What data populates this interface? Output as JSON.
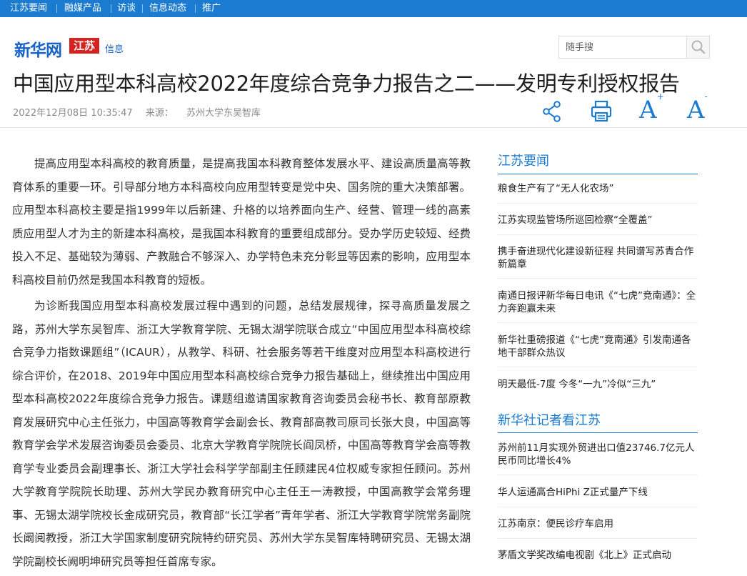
{
  "topnav": [
    "江苏要闻",
    "融媒产品",
    "访谈",
    "信息动态",
    "推广"
  ],
  "header": {
    "logo_main": "新华网",
    "logo_region": "江苏",
    "logo_section": "信息",
    "search_placeholder": "随手搜"
  },
  "article": {
    "title": "中国应用型本科高校2022年度综合竞争力报告之二——发明专利授权报告",
    "datetime": "2022年12月08日 10:35:47",
    "source_label": "来源：",
    "source": "苏州大学东吴智库",
    "paragraphs": [
      "提高应用型本科高校的教育质量，是提高我国本科教育整体发展水平、建设高质量高等教育体系的重要一环。引导部分地方本科高校向应用型转变是党中央、国务院的重大决策部署。应用型本科高校主要是指1999年以后新建、升格的以培养面向生产、经营、管理一线的高素质应用型人才为主的新建本科高校，是我国本科教育的重要组成部分。受办学历史较短、经费投入不足、基础较为薄弱、产教融合不够深入、办学特色未充分彰显等因素的影响，应用型本科高校目前仍然是我国本科教育的短板。",
      "为诊断我国应用型本科高校发展过程中遇到的问题，总结发展规律，探寻高质量发展之路，苏州大学东吴智库、浙江大学教育学院、无锡太湖学院联合成立“中国应用型本科高校综合竞争力指数课题组”（ICAUR），从教学、科研、社会服务等若干维度对应用型本科高校进行综合评价，在2018、2019年中国应用型本科高校综合竞争力报告基础上，继续推出中国应用型本科高校2022年度综合竞争力报告。课题组邀请国家教育咨询委员会秘书长、教育部原教育发展研究中心主任张力，中国高等教育学会副会长、教育部高教司原司长张大良，中国高等教育学会学术发展咨询委员会委员、北京大学教育学院院长阎凤桥，中国高等教育学会高等教育学专业委员会副理事长、浙江大学社会科学学部副主任顾建民4位权威专家担任顾问。苏州大学教育学院院长助理、苏州大学民办教育研究中心主任王一涛教授，中国高教学会常务理事、无锡太湖学院校长金成研究员，教育部“长江学者”青年学者、浙江大学教育学院常务副院长阚阅教授，浙江大学国家制度研究院特约研究员、苏州大学东吴智库特聘研究员、无锡太湖学院副校长阙明坤研究员等担任首席专家。"
    ]
  },
  "toolbar": {
    "font_increase": "A",
    "font_decrease": "A",
    "plus_sign": "+",
    "minus_sign": "-"
  },
  "sidebar": {
    "section1_title": "江苏要闻",
    "section1_items": [
      "粮食生产有了“无人化农场”",
      "江苏实现监管场所巡回检察“全覆盖”",
      "携手奋进现代化建设新征程 共同谱写苏青合作新篇章",
      "南通日报评新华每日电讯《“七虎”竞南通》：全力奔跑赢未来",
      "新华社重磅报道《“七虎”竞南通》引发南通各地干部群众热议",
      "明天最低-7度 今冬“一九”冷似“三九”"
    ],
    "section2_title": "新华社记者看江苏",
    "section2_items": [
      "苏州前11月实现外贸进出口值23746.7亿元人民币同比增长4%",
      "华人运通高合HiPhi Z正式量产下线",
      "江苏南京：便民诊疗车启用",
      "茅盾文学奖改编电视剧《北上》正式启动"
    ]
  },
  "colors": {
    "brand_blue": "#1a7bd0",
    "logo_red": "#d7231f"
  }
}
